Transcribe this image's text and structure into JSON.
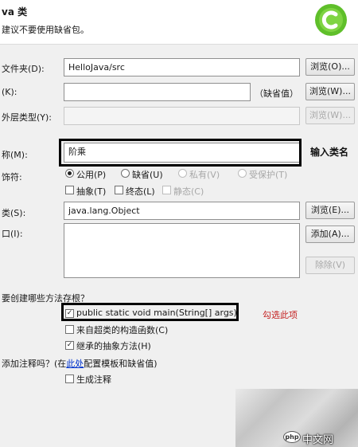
{
  "header": {
    "title": "va 类",
    "subtitle": "建议不要使用缺省包。"
  },
  "form": {
    "source_folder": {
      "label": "文件夹(D):",
      "value": "HelloJava/src",
      "browse": "浏览(O)..."
    },
    "package": {
      "label": "(K):",
      "value": "",
      "default_hint": "（缺省值）",
      "browse": "浏览(W)..."
    },
    "enclosing": {
      "label": "外层类型(Y):",
      "value": "",
      "browse": "浏览(W)..."
    },
    "name": {
      "label": "称(M):",
      "value": "阶乘"
    },
    "modifiers": {
      "label": "饰符:",
      "radios": [
        {
          "label": "公用(P)",
          "checked": true,
          "enabled": true
        },
        {
          "label": "缺省(U)",
          "checked": false,
          "enabled": true
        },
        {
          "label": "私有(V)",
          "checked": false,
          "enabled": false
        },
        {
          "label": "受保护(T)",
          "checked": false,
          "enabled": false
        }
      ],
      "checks": [
        {
          "label": "抽象(T)",
          "checked": false,
          "enabled": true
        },
        {
          "label": "终态(L)",
          "checked": false,
          "enabled": true
        },
        {
          "label": "静态(C)",
          "checked": false,
          "enabled": false
        }
      ]
    },
    "superclass": {
      "label": "类(S):",
      "value": "java.lang.Object",
      "browse": "浏览(E)..."
    },
    "interfaces": {
      "label": "口(I):",
      "add": "添加(A)...",
      "remove": "除除(V)"
    },
    "stubs": {
      "question": "要创建哪些方法存根？",
      "items": [
        {
          "label": "public static void main(String[] args)",
          "checked": true
        },
        {
          "label": "来自超类的构造函数(C)",
          "checked": false
        },
        {
          "label": "继承的抽象方法(H)",
          "checked": true
        }
      ]
    },
    "comments": {
      "question_pre": "添加注释吗？(在",
      "link": "此处",
      "question_post": "配置模板和缺省值)",
      "generate": {
        "label": "生成注释",
        "checked": false
      }
    }
  },
  "annotations": {
    "name_note": "输入类名",
    "main_note": "勾选此项"
  },
  "watermark": {
    "text": "中文网",
    "badge": "php"
  },
  "colors": {
    "logo": "#5fbf2a",
    "link": "#0033cc",
    "note_red": "#c42020"
  }
}
